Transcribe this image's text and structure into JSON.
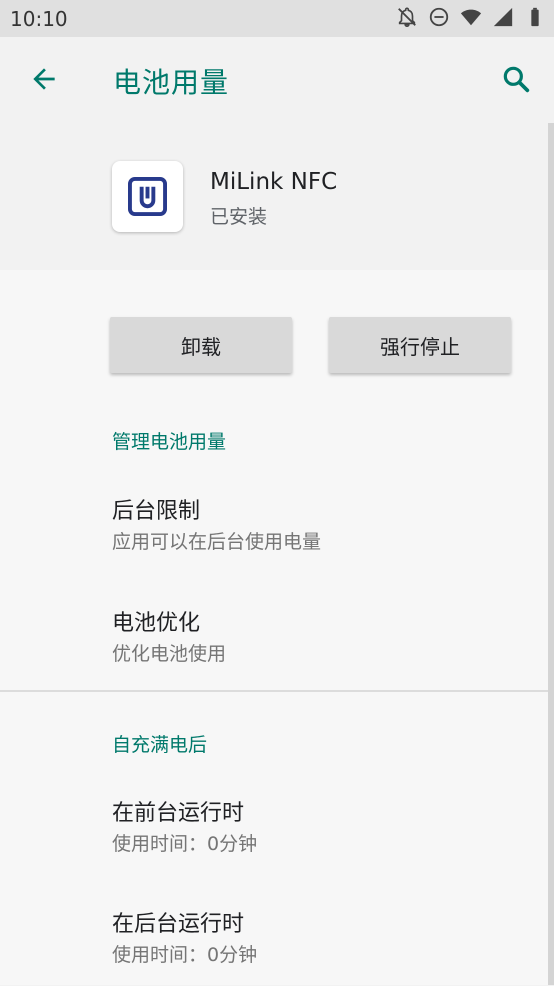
{
  "status_bar": {
    "time": "10:10",
    "icons": [
      "notifications-off-icon",
      "do-not-disturb-icon",
      "wifi-icon",
      "cellular-signal-icon",
      "battery-icon"
    ]
  },
  "app_bar": {
    "title": "电池用量",
    "back_icon": "arrow-back-icon",
    "search_icon": "search-icon",
    "accent_color": "#00796b"
  },
  "app_header": {
    "name": "MiLink NFC",
    "status": "已安装",
    "icon": "milink-nfc-app-icon",
    "icon_color": "#283a8c"
  },
  "actions": {
    "uninstall_label": "卸载",
    "force_stop_label": "强行停止"
  },
  "manage_section": {
    "header": "管理电池用量",
    "items": [
      {
        "title": "后台限制",
        "summary": "应用可以在后台使用电量"
      },
      {
        "title": "电池优化",
        "summary": "优化电池使用"
      }
    ]
  },
  "since_charge_section": {
    "header": "自充满电后",
    "items": [
      {
        "title": "在前台运行时",
        "summary": "使用时间：0分钟"
      },
      {
        "title": "在后台运行时",
        "summary": "使用时间：0分钟"
      }
    ]
  }
}
